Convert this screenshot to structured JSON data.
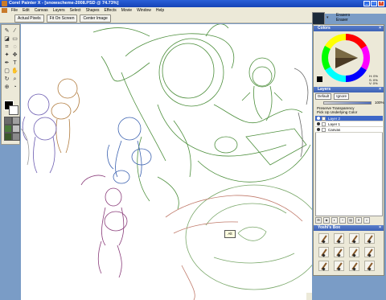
{
  "window": {
    "title": "Corel Painter X - [snowscheme-2008.PSD @ 74.73%]",
    "controls": [
      "_",
      "□",
      "×"
    ]
  },
  "menu": [
    "File",
    "Edit",
    "Canvas",
    "Layers",
    "Select",
    "Shapes",
    "Effects",
    "Movie",
    "Window",
    "Help"
  ],
  "brush_selector": {
    "category": "Erasers",
    "variant": "Eraser",
    "icon": "brush-category-icon"
  },
  "property_bar": {
    "buttons": [
      "Actual Pixels",
      "Fit On Screen",
      "Center Image"
    ]
  },
  "toolbox": {
    "tools": [
      "brush-icon",
      "dropper-icon",
      "paint-bucket-icon",
      "eraser-icon",
      "crop-icon",
      "lasso-icon",
      "magic-wand-icon",
      "move-icon",
      "pen-icon",
      "text-icon",
      "shape-icon",
      "grabber-icon",
      "rotate-icon",
      "magnifier-icon",
      "cloner-icon",
      "divine-proportion-icon"
    ],
    "main_color": "#000000",
    "additional_color": "#ffffff"
  },
  "canvas": {
    "tooltip": "Alt"
  },
  "colors_palette": {
    "title": "Colors",
    "hsv": [
      "H: 0%",
      "S: 0%",
      "V: 0%"
    ]
  },
  "layers_palette": {
    "title": "Layers",
    "composite_method": "Default",
    "preserve": "Ignore",
    "opacity": "100%",
    "opacity_fraction": 1.0,
    "options": [
      "Preserve Transparency",
      "Pick Up Underlying Color"
    ],
    "layers": [
      {
        "name": "Layer 2",
        "selected": true
      },
      {
        "name": "Layer 1",
        "selected": false
      },
      {
        "name": "Canvas",
        "selected": false
      }
    ]
  },
  "custom_palette": {
    "title": "Yoshi's Box"
  }
}
